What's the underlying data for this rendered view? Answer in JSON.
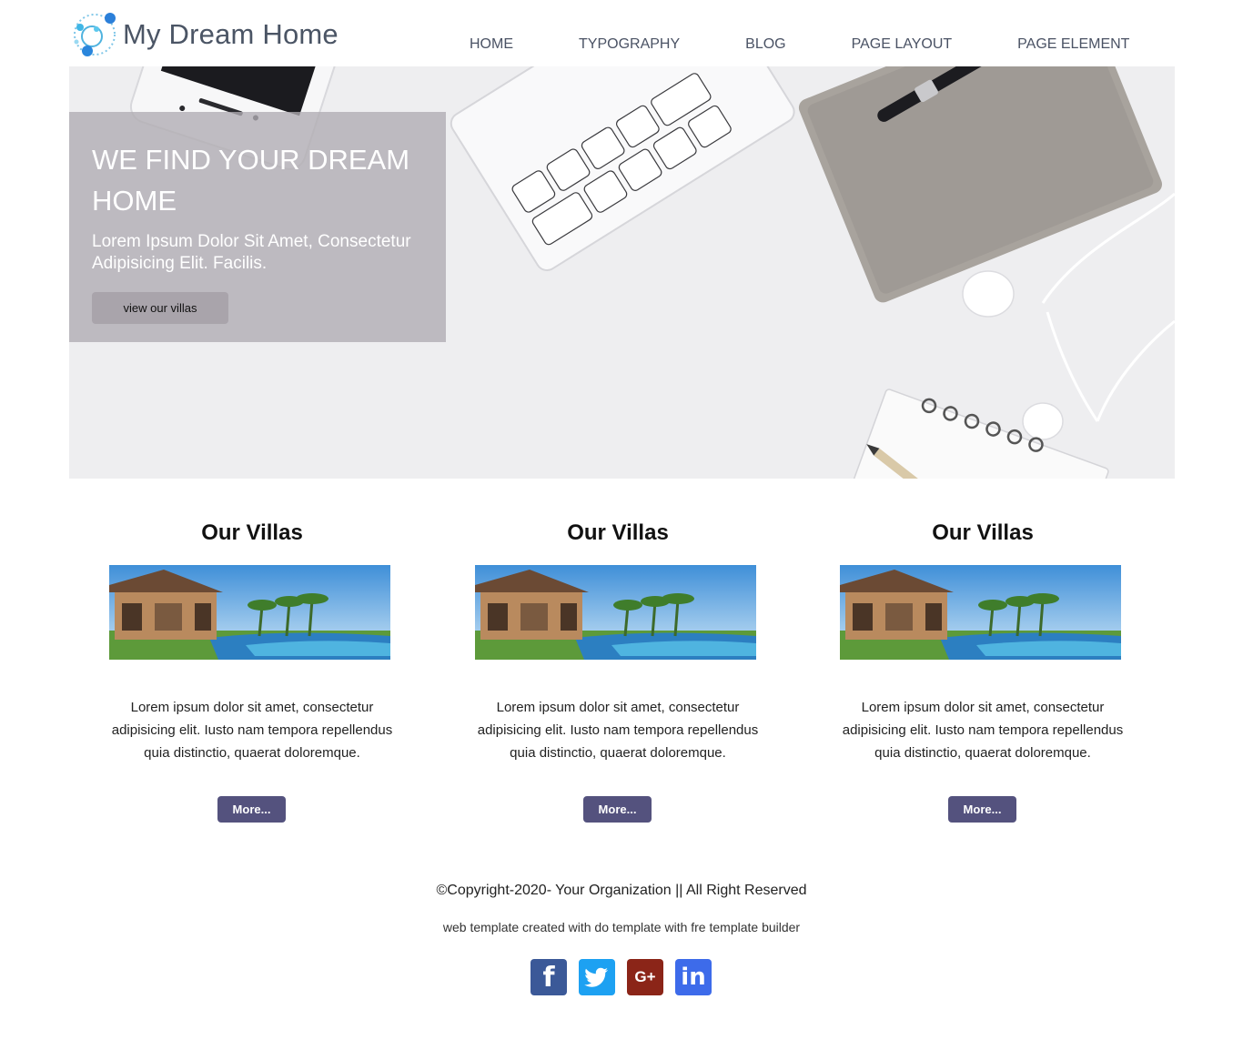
{
  "brand": {
    "name": "My Dream Home"
  },
  "nav": {
    "items": [
      {
        "label": "HOME"
      },
      {
        "label": "TYPOGRAPHY"
      },
      {
        "label": "BLOG"
      },
      {
        "label": "PAGE LAYOUT"
      },
      {
        "label": "PAGE ELEMENT"
      }
    ]
  },
  "hero": {
    "title": "WE FIND YOUR DREAM HOME",
    "subtitle": "Lorem Ipsum Dolor Sit Amet, Consectetur Adipisicing Elit. Facilis.",
    "button_label": "view our villas"
  },
  "cards": [
    {
      "title": "Our Villas",
      "text": "Lorem ipsum dolor sit amet, consectetur adipisicing elit. Iusto nam tempora repellendus quia distinctio, quaerat doloremque.",
      "button_label": "More..."
    },
    {
      "title": "Our Villas",
      "text": "Lorem ipsum dolor sit amet, consectetur adipisicing elit. Iusto nam tempora repellendus quia distinctio, quaerat doloremque.",
      "button_label": "More..."
    },
    {
      "title": "Our Villas",
      "text": "Lorem ipsum dolor sit amet, consectetur adipisicing elit. Iusto nam tempora repellendus quia distinctio, quaerat doloremque.",
      "button_label": "More..."
    }
  ],
  "footer": {
    "copyright": "©Copyright-2020- Your Organization || All Right Reserved",
    "credit": "web template created with do template with fre template builder"
  },
  "socials": [
    {
      "icon": "facebook-icon",
      "glyph": "f",
      "color": "#3b5998"
    },
    {
      "icon": "twitter-icon",
      "glyph": "t",
      "color": "#1da1f2"
    },
    {
      "icon": "google-plus-icon",
      "glyph": "G+",
      "color": "#8b2518"
    },
    {
      "icon": "linkedin-icon",
      "glyph": "in",
      "color": "#3d6bea"
    }
  ],
  "colors": {
    "accent_button": "#54527e",
    "hero_box": "#b0acb2",
    "nav_text": "#4a5264"
  }
}
